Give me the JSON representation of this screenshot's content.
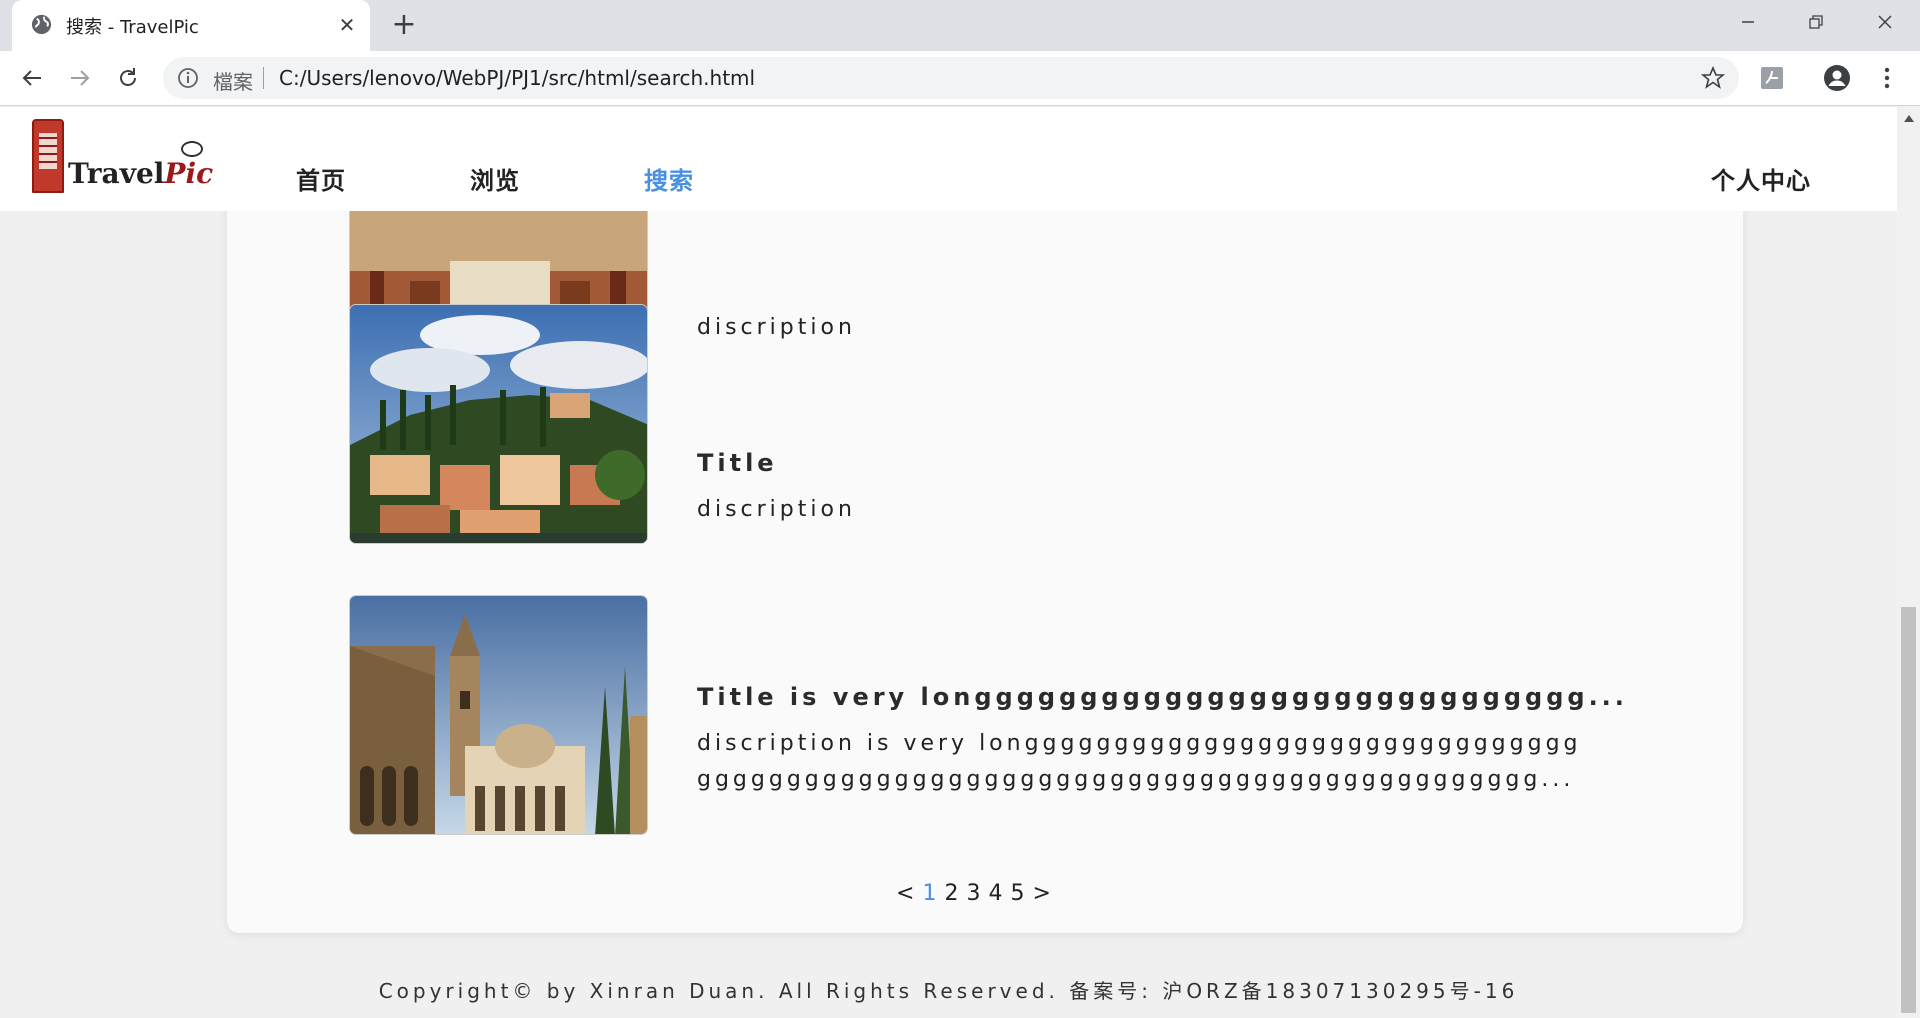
{
  "browser": {
    "tab_title": "搜索 - TravelPic",
    "tab_close": "✕",
    "new_tab": "+",
    "window_controls": {
      "minimize": "minimize-icon",
      "restore": "restore-icon",
      "close": "close-icon"
    },
    "omnibox": {
      "security_label": "檔案",
      "url": "C:/Users/lenovo/WebPJ/PJ1/src/html/search.html"
    }
  },
  "site": {
    "logo_text_main": "Travel",
    "logo_text_accent": "Pic",
    "nav": [
      {
        "label": "首页",
        "active": false
      },
      {
        "label": "浏览",
        "active": false
      },
      {
        "label": "搜索",
        "active": true
      }
    ],
    "user_center": "个人中心"
  },
  "results": [
    {
      "title": "",
      "description": "discription"
    },
    {
      "title": "Title",
      "description": "discription"
    },
    {
      "title": "Title is very longgggggggggggggggggggggggggggg...",
      "description_line1": "discription is very longgggggggggggggggggggggggggggggg",
      "description_line2": "ggggggggggggggggggggggggggggggggggggggggggggggg..."
    }
  ],
  "pagination": {
    "prev": "<",
    "pages": [
      "1",
      "2",
      "3",
      "4",
      "5"
    ],
    "current": "1",
    "next": ">"
  },
  "footer": "Copyright© by Xinran Duan. All Rights Reserved. 备案号: 沪ORZ备18307130295号-16",
  "colors": {
    "accent": "#4a90e2",
    "page_bg": "#f0f0f0",
    "card_bg": "#fafafa"
  }
}
